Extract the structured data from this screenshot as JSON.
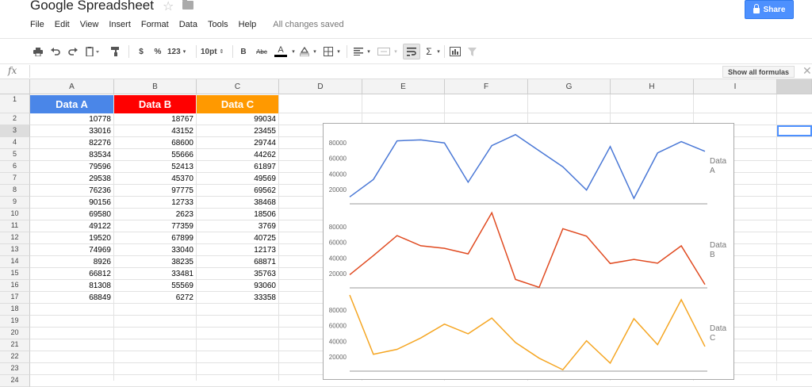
{
  "app": {
    "title": "Google Spreadsheet",
    "share_label": "Share",
    "save_status": "All changes saved",
    "show_formulas_label": "Show all formulas"
  },
  "menu": [
    "File",
    "Edit",
    "View",
    "Insert",
    "Format",
    "Data",
    "Tools",
    "Help"
  ],
  "toolbar": {
    "currency": "$",
    "percent": "%",
    "number_format": "123",
    "font_size": "10pt",
    "bold": "B",
    "strikethrough": "Abc",
    "text_color": "A",
    "sum": "Σ"
  },
  "formula_bar": {
    "label": "fx",
    "value": ""
  },
  "grid": {
    "columns": [
      "A",
      "B",
      "C",
      "D",
      "E",
      "F",
      "G",
      "H",
      "I"
    ],
    "rows": [
      "1",
      "2",
      "3",
      "4",
      "5",
      "6",
      "7",
      "8",
      "9",
      "10",
      "11",
      "12",
      "13",
      "14",
      "15",
      "16",
      "17",
      "18",
      "19",
      "20",
      "21",
      "22",
      "23",
      "24"
    ],
    "selected_row": "3",
    "headers": [
      {
        "label": "Data A",
        "color": "#4a86e8"
      },
      {
        "label": "Data B",
        "color": "#ff0000"
      },
      {
        "label": "Data C",
        "color": "#ff9900"
      }
    ],
    "data": [
      [
        10778,
        18767,
        99034
      ],
      [
        33016,
        43152,
        23455
      ],
      [
        82276,
        68600,
        29744
      ],
      [
        83534,
        55666,
        44262
      ],
      [
        79596,
        52413,
        61897
      ],
      [
        29538,
        45370,
        49569
      ],
      [
        76236,
        97775,
        69562
      ],
      [
        90156,
        12733,
        38468
      ],
      [
        69580,
        2623,
        18506
      ],
      [
        49122,
        77359,
        3769
      ],
      [
        19520,
        67899,
        40725
      ],
      [
        74969,
        33040,
        12173
      ],
      [
        8926,
        38235,
        68871
      ],
      [
        66812,
        33481,
        35763
      ],
      [
        81308,
        55569,
        93060
      ],
      [
        68849,
        6272,
        33358
      ]
    ]
  },
  "chart_data": {
    "type": "line",
    "y_ticks": [
      20000,
      40000,
      60000,
      80000
    ],
    "y_tick_labels": [
      "20000",
      "40000",
      "60000",
      "80000"
    ],
    "series": [
      {
        "name": "Data A",
        "color": "#4a78d6",
        "values": [
          10778,
          33016,
          82276,
          83534,
          79596,
          29538,
          76236,
          90156,
          69580,
          49122,
          19520,
          74969,
          8926,
          66812,
          81308,
          68849
        ]
      },
      {
        "name": "Data B",
        "color": "#e04a20",
        "values": [
          18767,
          43152,
          68600,
          55666,
          52413,
          45370,
          97775,
          12733,
          2623,
          77359,
          67899,
          33040,
          38235,
          33481,
          55569,
          6272
        ]
      },
      {
        "name": "Data C",
        "color": "#f5a623",
        "values": [
          99034,
          23455,
          29744,
          44262,
          61897,
          49569,
          69562,
          38468,
          18506,
          3769,
          40725,
          12173,
          68871,
          35763,
          93060,
          33358
        ]
      }
    ]
  }
}
